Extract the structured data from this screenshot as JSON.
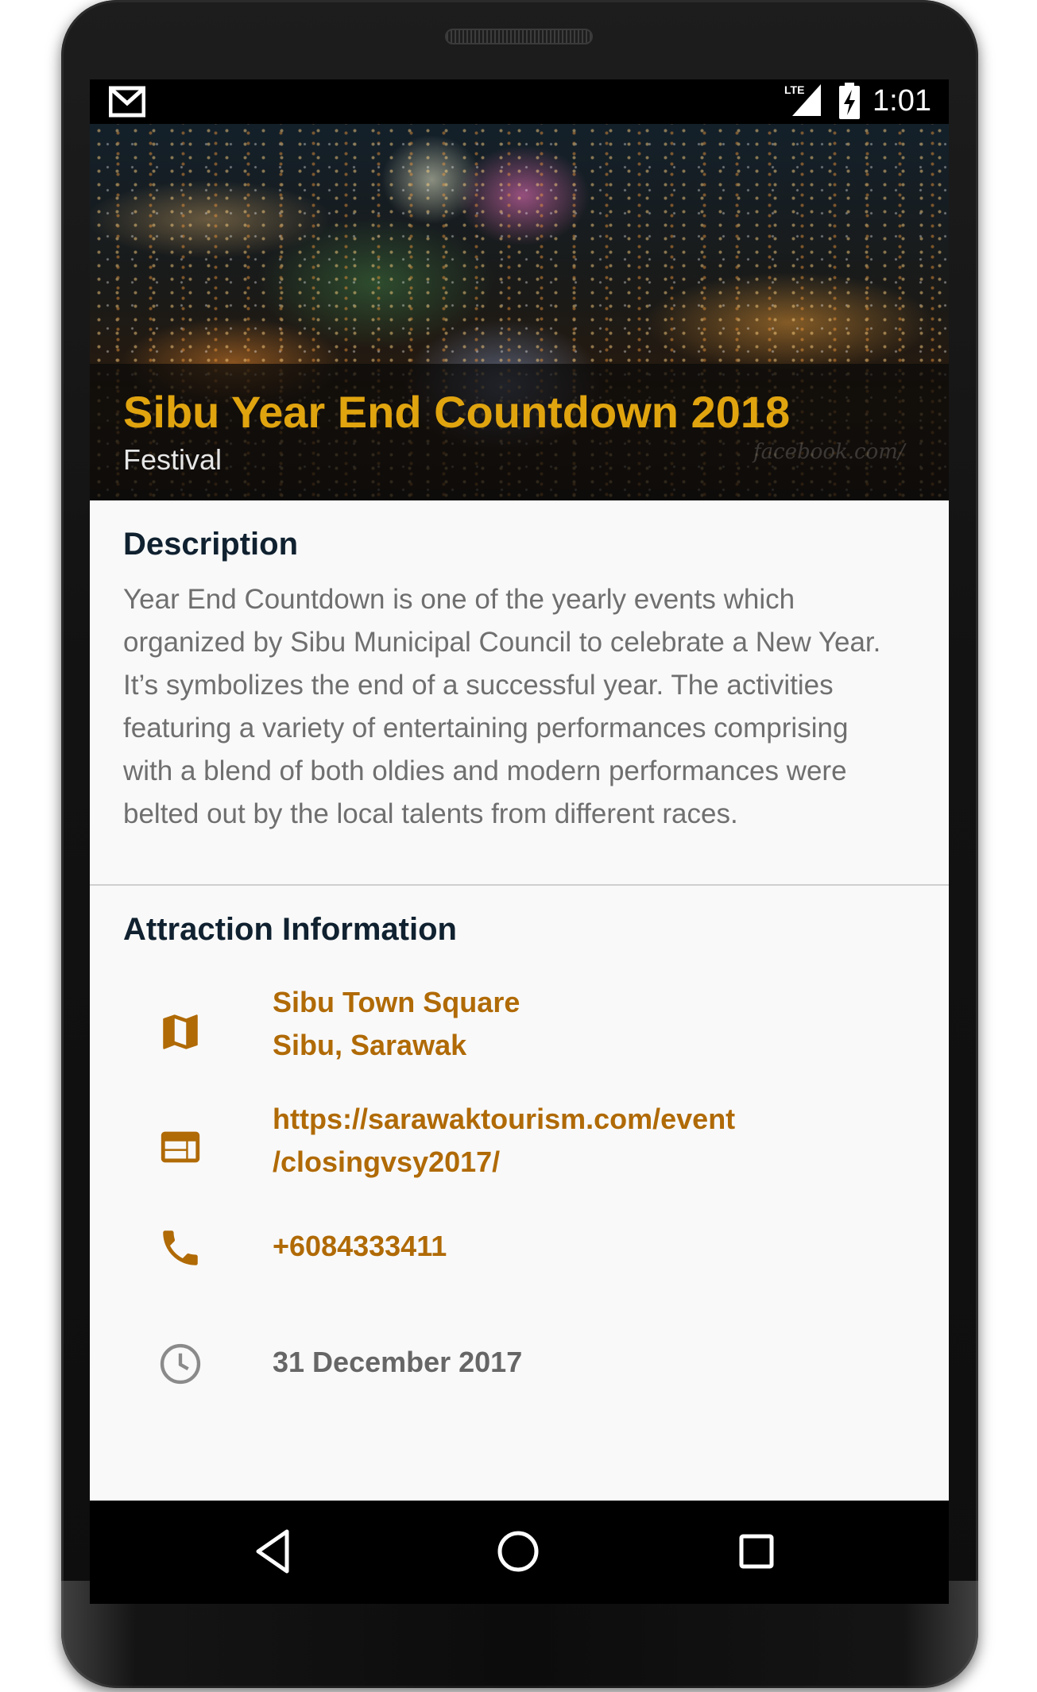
{
  "status_bar": {
    "time": "1:01",
    "network": "LTE",
    "notification_icon": "gmail-icon",
    "battery_icon": "battery-charging-icon"
  },
  "hero": {
    "title": "Sibu Year End Countdown 2018",
    "category": "Festival",
    "watermark": "facebook.com/"
  },
  "description": {
    "heading": "Description",
    "lines": [
      "Year End Countdown is one of the yearly events which",
      "organized by Sibu Municipal Council to celebrate a New Year.",
      "It’s symbolizes the end of a successful year. The activities",
      "featuring a variety of entertaining performances comprising",
      "with a blend of both oldies and modern performances were",
      "belted out by the local talents from different races."
    ]
  },
  "attraction": {
    "heading": "Attraction Information",
    "location": {
      "icon": "map-icon",
      "line1": "Sibu Town Square",
      "line2": "Sibu, Sarawak"
    },
    "website": {
      "icon": "web-icon",
      "line1": "https://sarawaktourism.com/event",
      "line2": "/closingvsy2017/"
    },
    "phone": {
      "icon": "phone-icon",
      "value": "+6084333411"
    },
    "date": {
      "icon": "clock-icon",
      "value": "31 December 2017"
    }
  },
  "nav": {
    "back_icon": "back-icon",
    "home_icon": "home-icon",
    "recents_icon": "recents-icon"
  },
  "colors": {
    "accent": "#b06a06",
    "title_gold": "#e0a40f",
    "heading": "#102130",
    "body_text": "#6f6f6f",
    "background": "#f9f9f9"
  }
}
